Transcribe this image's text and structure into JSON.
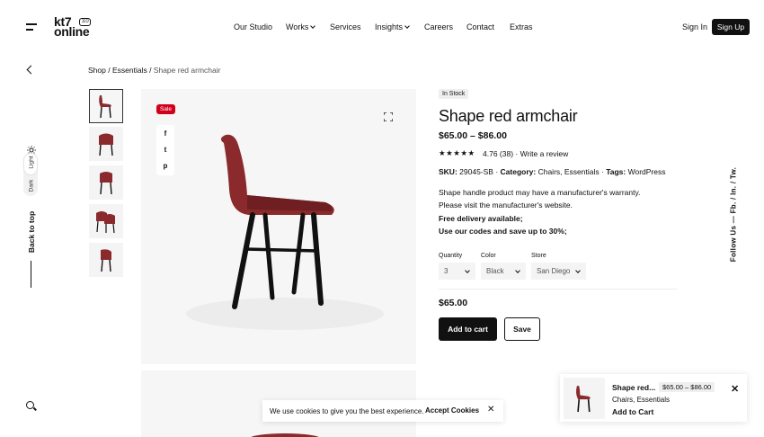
{
  "brand": {
    "line1": "kt7",
    "line2": "online",
    "badge": "3.0"
  },
  "nav": {
    "items": [
      {
        "label": "Our Studio"
      },
      {
        "label": "Works"
      },
      {
        "label": "Services"
      },
      {
        "label": "Insights"
      },
      {
        "label": "Careers"
      },
      {
        "label": "Contact"
      },
      {
        "label": "Extras"
      }
    ],
    "sign_in": "Sign In",
    "sign_up": "Sign Up"
  },
  "left_rail": {
    "mode_light": "Light",
    "mode_dark": "Dark",
    "back_to_top": "Back to top"
  },
  "breadcrumb": {
    "shop": "Shop",
    "sep": " / ",
    "category": "Essentials",
    "current": "Shape red armchair"
  },
  "gallery": {
    "sale_badge": "Sale",
    "share_icons": [
      "f",
      "t",
      "p"
    ]
  },
  "product": {
    "stock": "In Stock",
    "title": "Shape red armchair",
    "price_range": "$65.00 – $86.00",
    "stars": "★★★★★",
    "rating_text": "4.76 (38) · ",
    "write_review": "Write a review",
    "sku_label": "SKU:",
    "sku": "29045-SB",
    "category_label": "Category:",
    "categories": "Chairs, Essentials",
    "tags_label": "Tags:",
    "tags": "WordPress",
    "desc_1": "Shape handle product may have a manufacturer's warranty.",
    "desc_2": "Please visit the manufacturer's website.",
    "desc_3": "Free delivery available;",
    "desc_4": "Use our codes and save up to 30%;",
    "quantity_label": "Quantity",
    "quantity_value": "3",
    "color_label": "Color",
    "color_value": "Black",
    "store_label": "Store",
    "store_value": "San Diego",
    "price": "$65.00",
    "add_to_cart": "Add to cart",
    "save": "Save"
  },
  "follow": "Follow Us — Fb. / In. / Tw.",
  "cookie": {
    "text": "We use cookies to give you the best experience.",
    "accept": "Accept Cookies",
    "close": "✕"
  },
  "sticky_cart": {
    "name": "Shape red...",
    "price": "$65.00 – $86.00",
    "categories": "Chairs, Essentials",
    "add": "Add to Cart",
    "close": "✕"
  },
  "colors": {
    "accent": "#111111",
    "sale": "#d0021b",
    "chair": "#8b2a2c"
  }
}
